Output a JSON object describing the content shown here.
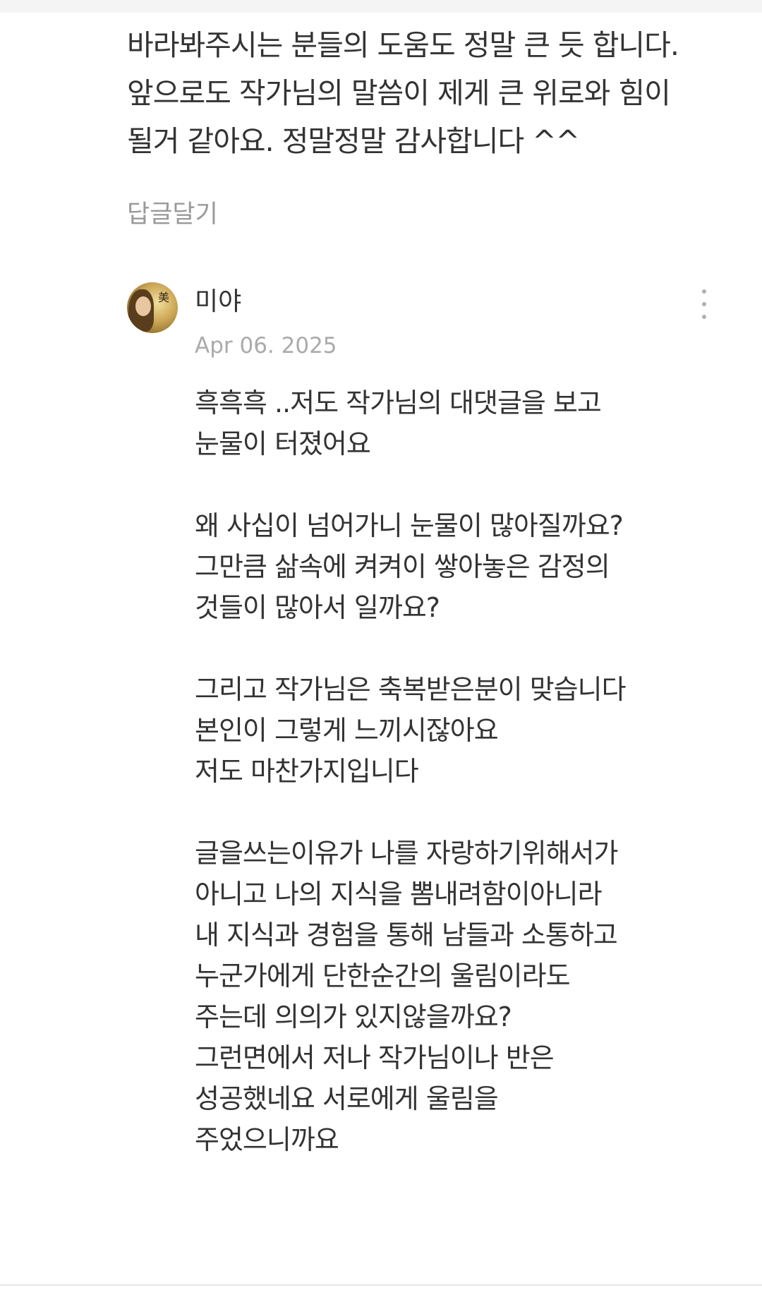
{
  "previous_reply": {
    "text": "바라봐주시는 분들의 도움도 정말 큰 듯 합니다.\n앞으로도 작가님의 말씀이 제게 큰 위로와 힘이\n될거 같아요. 정말정말 감사합니다 ^^",
    "reply_label": "답글달기"
  },
  "comment": {
    "author": "미야",
    "date": "Apr 06. 2025",
    "avatar_icon": "profile-photo",
    "more_icon": "more-vertical-icon",
    "body": "흑흑흑 ..저도 작가님의 대댓글을 보고\n눈물이 터졌어요\n\n왜 사십이 넘어가니 눈물이 많아질까요?\n그만큼 삶속에 켜켜이 쌓아놓은 감정의\n것들이 많아서 일까요?\n\n그리고 작가님은 축복받은분이 맞습니다\n본인이 그렇게 느끼시잖아요\n저도 마찬가지입니다\n\n글을쓰는이유가 나를 자랑하기위해서가\n아니고 나의 지식을 뽐내려함이아니라\n내 지식과 경험을 통해 남들과 소통하고\n누군가에게 단한순간의 울림이라도\n주는데 의의가 있지않을까요?\n그런면에서 저나 작가님이나 반은\n성공했네요 서로에게 울림을\n주었으니까요"
  }
}
